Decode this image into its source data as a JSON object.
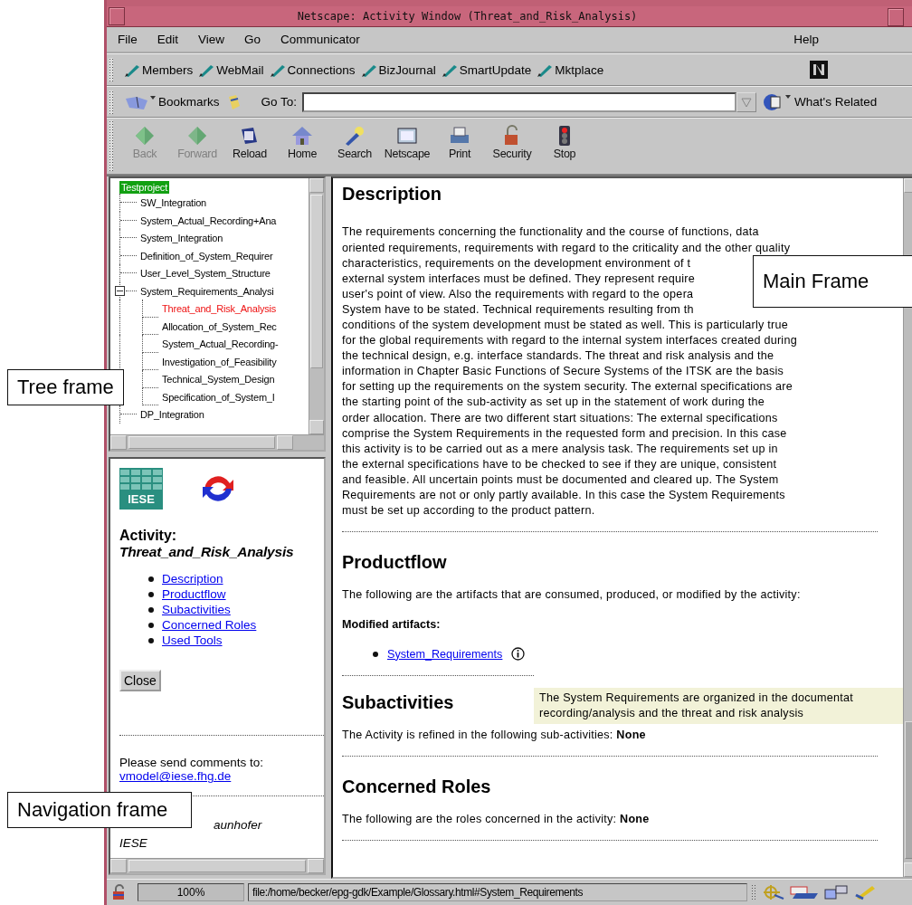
{
  "window": {
    "title": "Netscape: Activity Window (Threat_and_Risk_Analysis)"
  },
  "menu": [
    {
      "label": "File"
    },
    {
      "label": "Edit"
    },
    {
      "label": "View"
    },
    {
      "label": "Go"
    },
    {
      "label": "Communicator"
    },
    {
      "label": "Help"
    }
  ],
  "personal_toolbar": [
    "Members",
    "WebMail",
    "Connections",
    "BizJournal",
    "SmartUpdate",
    "Mktplace"
  ],
  "location_bar": {
    "bookmarks": "Bookmarks",
    "goto_label": "Go To:",
    "related": "What's Related"
  },
  "nav_toolbar": [
    {
      "label": "Back",
      "disabled": true
    },
    {
      "label": "Forward",
      "disabled": true
    },
    {
      "label": "Reload",
      "disabled": false
    },
    {
      "label": "Home",
      "disabled": false
    },
    {
      "label": "Search",
      "disabled": false
    },
    {
      "label": "Netscape",
      "disabled": false
    },
    {
      "label": "Print",
      "disabled": false
    },
    {
      "label": "Security",
      "disabled": false
    },
    {
      "label": "Stop",
      "disabled": false
    }
  ],
  "tree": {
    "label": "Testproject",
    "selected": true,
    "current": false,
    "children": [
      {
        "label": "SW_Integration",
        "selected": false,
        "current": false
      },
      {
        "label": "System_Actual_Recording+Ana",
        "selected": false,
        "current": false
      },
      {
        "label": "System_Integration",
        "selected": false,
        "current": false
      },
      {
        "label": "Definition_of_System_Requirer",
        "selected": false,
        "current": false
      },
      {
        "label": "User_Level_System_Structure",
        "selected": false,
        "current": false
      },
      {
        "label": "System_Requirements_Analysi",
        "selected": false,
        "current": false,
        "expanded": true,
        "children": [
          {
            "label": "Threat_and_Risk_Analysis",
            "selected": false,
            "current": true
          },
          {
            "label": "Allocation_of_System_Rec",
            "selected": false,
            "current": false
          },
          {
            "label": "System_Actual_Recording-",
            "selected": false,
            "current": false
          },
          {
            "label": "Investigation_of_Feasibility",
            "selected": false,
            "current": false
          },
          {
            "label": "Technical_System_Design",
            "selected": false,
            "current": false
          },
          {
            "label": "Specification_of_System_I",
            "selected": false,
            "current": false
          }
        ]
      },
      {
        "label": "DP_Integration",
        "selected": false,
        "current": false
      }
    ]
  },
  "navigation": {
    "logo_text": "IESE",
    "heading": "Activity:",
    "activity": "Threat_and_Risk_Analysis",
    "links": [
      "Description",
      "Productflow",
      "Subactivities",
      "Concerned Roles",
      "Used Tools"
    ],
    "close_button": "Close",
    "comments": "Please send comments to:",
    "email": "vmodel@iese.fhg.de",
    "footer": [
      "aunhofer",
      "IESE"
    ]
  },
  "main": {
    "description": {
      "heading": "Description",
      "lines": [
        "The requirements concerning the functionality and the course of functions, data",
        "oriented requirements, requirements with regard to the criticality and the other quality",
        "characteristics, requirements on the development environment of t",
        "external system interfaces must be defined. They represent require",
        "user's point of view. Also the requirements with regard to the opera",
        "System have to be stated. Technical requirements resulting from th",
        "conditions of the system development must be stated as well. This is particularly true",
        "for the global requirements with regard to the internal system interfaces created during",
        "the technical design, e.g. interface standards. The threat and risk analysis and the",
        "information in Chapter Basic Functions of Secure Systems of the ITSK are the basis",
        "for setting up the requirements on the system security. The external specifications are",
        "the starting point of the sub-activity as set up in the statement of work during the",
        "order allocation. There are two different start situations: The external specifications",
        "comprise the System Requirements in the requested form and precision. In this case",
        "this activity is to be carried out as a mere analysis task. The requirements set up in",
        "the external specifications have to be checked to see if they are unique, consistent",
        "and feasible. All uncertain points must be documented and cleared up. The System",
        "Requirements are not or only partly available. In this case the System Requirements",
        "must be set up according to the product pattern."
      ]
    },
    "productflow": {
      "heading": "Productflow",
      "text": "The following are the artifacts that are consumed, produced, or modified by the activity:",
      "subheading": "Modified artifacts:",
      "artifacts": [
        "System_Requirements "
      ]
    },
    "tooltip": [
      "The System Requirements are organized in the documentat",
      "recording/analysis and the threat and risk analysis"
    ],
    "subactivities": {
      "heading": "Subactivities",
      "text": "The Activity is refined in the following sub-activities: **None**"
    },
    "roles": {
      "heading": "Concerned Roles",
      "text": "The following are the roles concerned in the activity: **None**"
    }
  },
  "status_bar": {
    "zoom": "100%",
    "url": "file:/home/becker/epg-gdk/Example/Glossary.html#System_Requirements"
  },
  "callouts": [
    {
      "label": "Tree frame"
    },
    {
      "label": "Main Frame"
    },
    {
      "label": "Navigation frame"
    }
  ]
}
